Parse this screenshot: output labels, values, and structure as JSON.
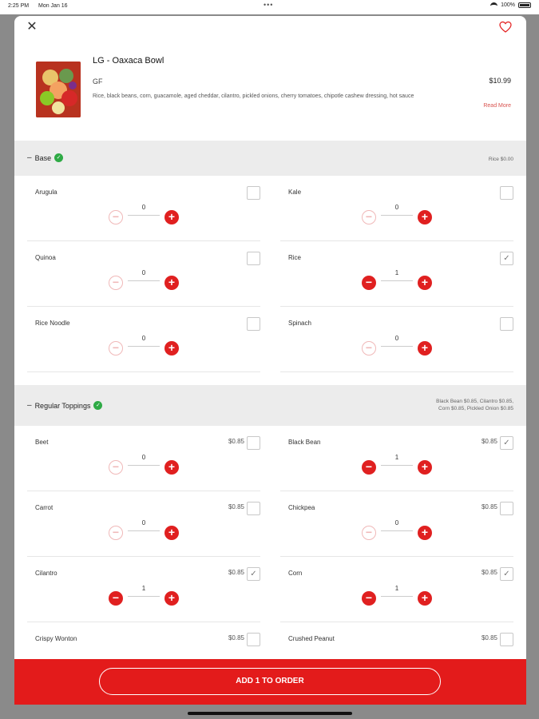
{
  "status_bar": {
    "time": "2:25 PM",
    "date": "Mon Jan 16",
    "battery": "100%",
    "dots": "•••"
  },
  "product": {
    "title": "LG - Oaxaca Bowl",
    "tag": "GF",
    "price": "$10.99",
    "description": "Rice, black beans, corn, guacamole, aged cheddar, cilantro, pickled onions, cherry tomatoes, chipotle cashew dressing, hot sauce",
    "read_more": "Read More"
  },
  "icons": {
    "close": "✕",
    "collapse": "–",
    "check": "✓",
    "minus": "−",
    "plus": "+"
  },
  "sections": [
    {
      "title": "Base",
      "summary": "Rice $0.00",
      "options": [
        {
          "name": "Arugula",
          "price": "",
          "checked": false,
          "qty": "0"
        },
        {
          "name": "Kale",
          "price": "",
          "checked": false,
          "qty": "0"
        },
        {
          "name": "Quinoa",
          "price": "",
          "checked": false,
          "qty": "0"
        },
        {
          "name": "Rice",
          "price": "",
          "checked": true,
          "qty": "1"
        },
        {
          "name": "Rice Noodle",
          "price": "",
          "checked": false,
          "qty": "0"
        },
        {
          "name": "Spinach",
          "price": "",
          "checked": false,
          "qty": "0"
        }
      ]
    },
    {
      "title": "Regular Toppings",
      "summary_line1": "Black Bean $0.85, Cilantro $0.85,",
      "summary_line2": "Corn $0.85, Pickled Onion $0.85",
      "options": [
        {
          "name": "Beet",
          "price": "$0.85",
          "checked": false,
          "qty": "0"
        },
        {
          "name": "Black Bean",
          "price": "$0.85",
          "checked": true,
          "qty": "1"
        },
        {
          "name": "Carrot",
          "price": "$0.85",
          "checked": false,
          "qty": "0"
        },
        {
          "name": "Chickpea",
          "price": "$0.85",
          "checked": false,
          "qty": "0"
        },
        {
          "name": "Cilantro",
          "price": "$0.85",
          "checked": true,
          "qty": "1"
        },
        {
          "name": "Corn",
          "price": "$0.85",
          "checked": true,
          "qty": "1"
        },
        {
          "name": "Crispy Wonton",
          "price": "$0.85",
          "checked": false,
          "qty": ""
        },
        {
          "name": "Crushed Peanut",
          "price": "$0.85",
          "checked": false,
          "qty": ""
        }
      ]
    }
  ],
  "footer": {
    "add_button": "ADD 1 TO ORDER"
  },
  "colors": {
    "accent": "#e31b1b",
    "check_green": "#2eaa45",
    "read_more": "#d9534f"
  }
}
